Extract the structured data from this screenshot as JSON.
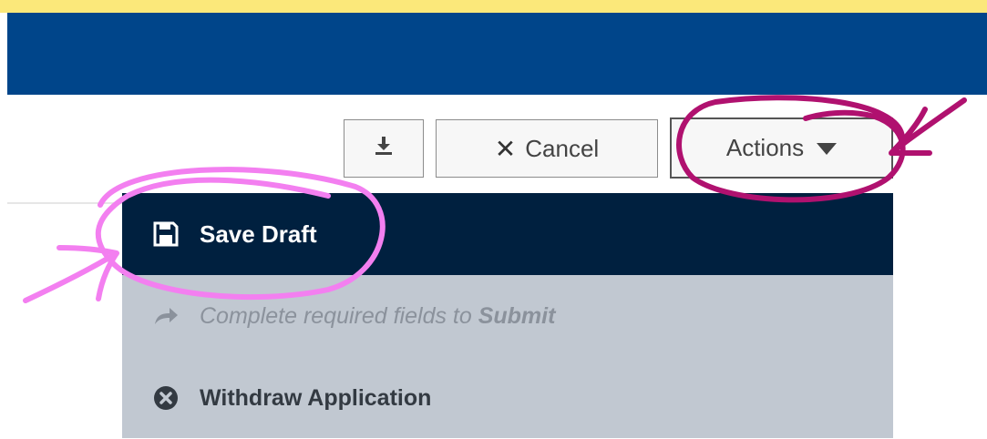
{
  "toolbar": {
    "download_icon": "download-icon",
    "cancel_label": "Cancel",
    "actions_label": "Actions"
  },
  "menu": {
    "save_draft_label": "Save Draft",
    "submit_hint_prefix": "Complete required fields to ",
    "submit_hint_bold": "Submit",
    "withdraw_label": "Withdraw Application"
  },
  "colors": {
    "header": "#00458a",
    "top_strip": "#fbe87a",
    "menu_active": "#00203f",
    "menu_bg": "#c1c8d1",
    "annotation_pink": "#f37ff0",
    "annotation_magenta": "#b0116f"
  }
}
